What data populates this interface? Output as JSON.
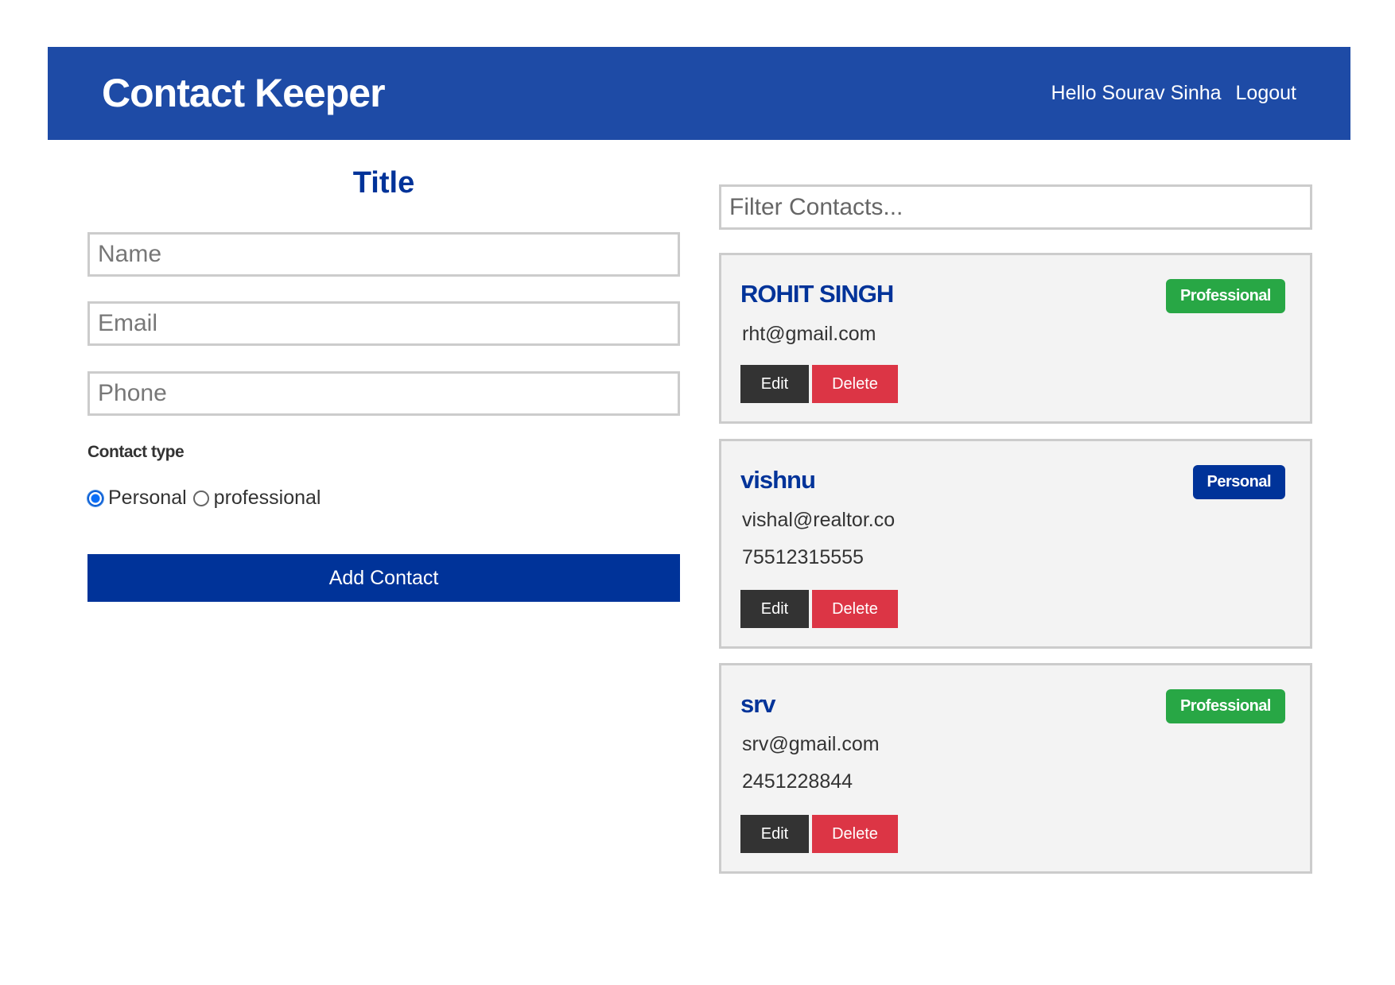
{
  "navbar": {
    "brand": "Contact Keeper",
    "greeting": "Hello Sourav Sinha",
    "logout_label": "Logout"
  },
  "form": {
    "title": "Title",
    "name_placeholder": "Name",
    "email_placeholder": "Email",
    "phone_placeholder": "Phone",
    "type_label": "Contact type",
    "radio_options": [
      {
        "label": "Personal",
        "checked": true
      },
      {
        "label": "professional",
        "checked": false
      }
    ],
    "submit_label": "Add Contact"
  },
  "filter": {
    "placeholder": "Filter Contacts..."
  },
  "contacts": [
    {
      "name": "ROHIT SINGH",
      "type": "Professional",
      "email": "rht@gmail.com",
      "phone": "",
      "edit_label": "Edit",
      "delete_label": "Delete"
    },
    {
      "name": "vishnu",
      "type": "Personal",
      "email": "vishal@realtor.co",
      "phone": "75512315555",
      "edit_label": "Edit",
      "delete_label": "Delete"
    },
    {
      "name": "srv",
      "type": "Professional",
      "email": "srv@gmail.com",
      "phone": "2451228844",
      "edit_label": "Edit",
      "delete_label": "Delete"
    }
  ],
  "colors": {
    "navbar": "#1e4ba6",
    "primary": "#003399",
    "success": "#28a745",
    "danger": "#dc3545",
    "dark": "#333333",
    "card_bg": "#f3f3f3"
  }
}
